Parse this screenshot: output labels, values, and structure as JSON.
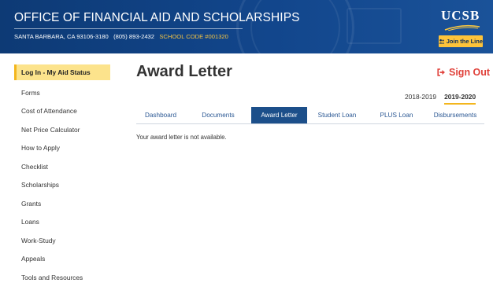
{
  "header": {
    "title": "OFFICE OF FINANCIAL AID AND SCHOLARSHIPS",
    "address": "SANTA BARBARA, CA 93106-3180",
    "phone": "(805) 893-2432",
    "school_code": "SCHOOL CODE #001320",
    "logo_text": "UCSB",
    "join_label": "Join the Line",
    "colors": {
      "primary": "#0f3d7a",
      "accent": "#fdc33a"
    }
  },
  "sidebar": {
    "items": [
      {
        "label": "Log In - My Aid Status",
        "active": true
      },
      {
        "label": "Forms"
      },
      {
        "label": "Cost of Attendance"
      },
      {
        "label": "Net Price Calculator"
      },
      {
        "label": "How to Apply"
      },
      {
        "label": "Checklist"
      },
      {
        "label": "Scholarships"
      },
      {
        "label": "Grants"
      },
      {
        "label": "Loans"
      },
      {
        "label": "Work-Study"
      },
      {
        "label": "Appeals"
      },
      {
        "label": "Tools and Resources"
      }
    ]
  },
  "main": {
    "title": "Award Letter",
    "signout_label": "Sign Out",
    "signout_icon": "sign-out-icon",
    "years": [
      {
        "label": "2018-2019",
        "active": false
      },
      {
        "label": "2019-2020",
        "active": true
      }
    ],
    "tabs": [
      {
        "label": "Dashboard",
        "active": false
      },
      {
        "label": "Documents",
        "active": false
      },
      {
        "label": "Award Letter",
        "active": true
      },
      {
        "label": "Student Loan",
        "active": false
      },
      {
        "label": "PLUS Loan",
        "active": false
      },
      {
        "label": "Disbursements",
        "active": false
      }
    ],
    "message": "Your award letter is not available."
  }
}
